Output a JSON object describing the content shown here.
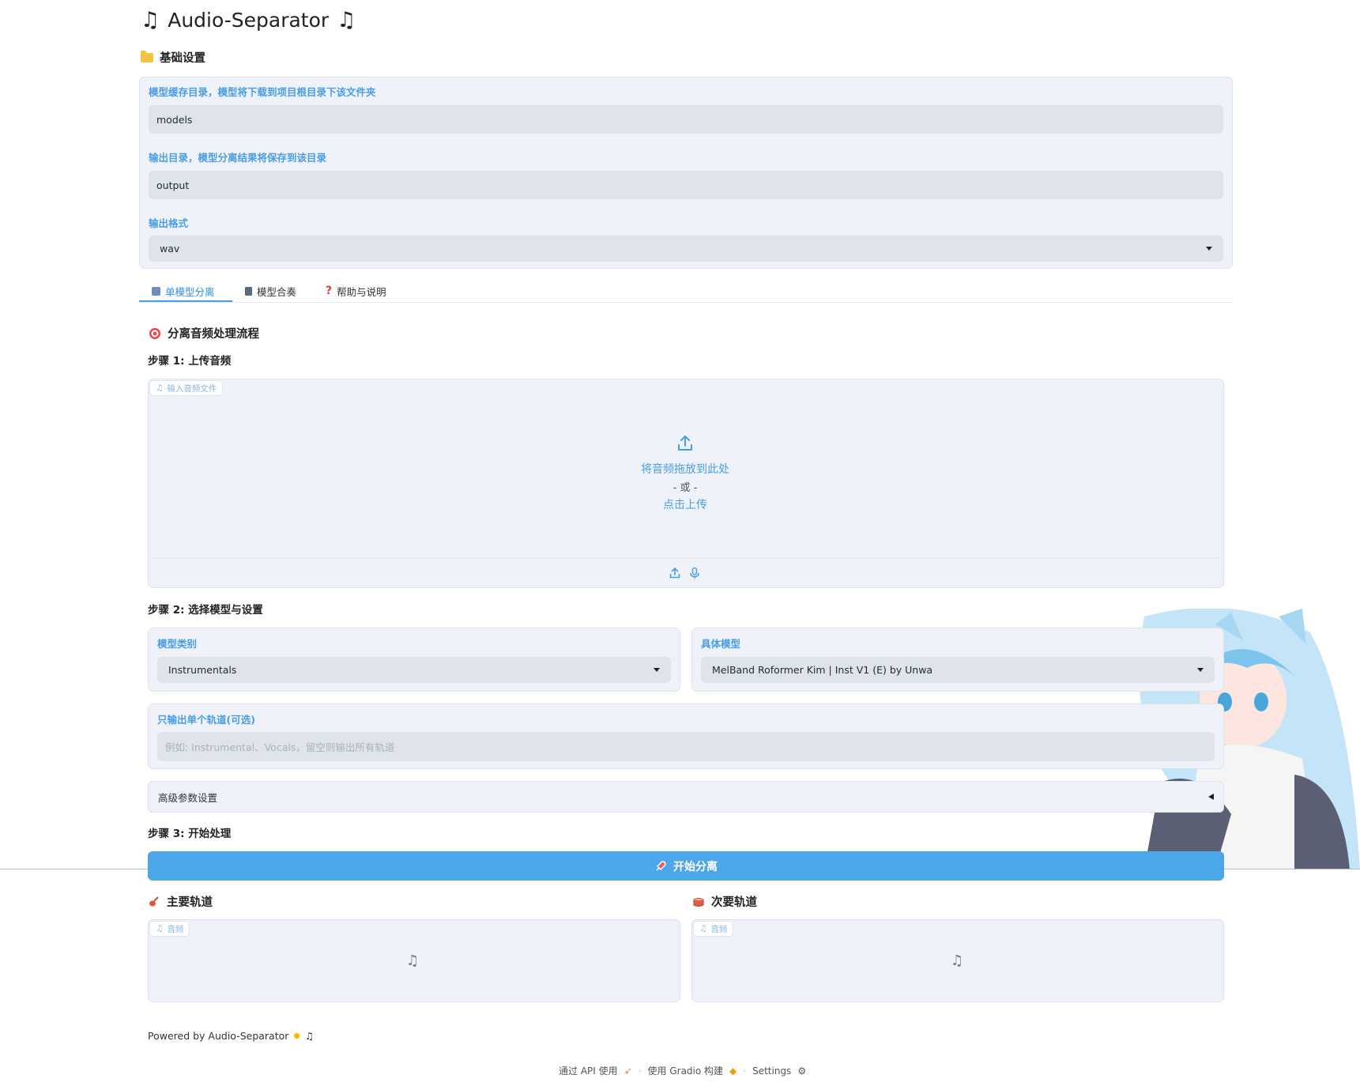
{
  "app": {
    "title": "Audio-Separator",
    "note_glyph": "♫"
  },
  "basic_settings": {
    "heading": "基础设置",
    "model_dir": {
      "label": "模型缓存目录，模型将下载到项目根目录下该文件夹",
      "value": "models"
    },
    "output_dir": {
      "label": "输出目录，模型分离结果将保存到该目录",
      "value": "output"
    },
    "output_format": {
      "label": "输出格式",
      "value": "wav"
    }
  },
  "tabs": [
    {
      "label": "单模型分离",
      "active": true
    },
    {
      "label": "模型合奏",
      "active": false
    },
    {
      "label": "帮助与说明",
      "active": false
    }
  ],
  "flow": {
    "heading": "分离音频处理流程",
    "step1": "步骤 1: 上传音频",
    "upload": {
      "chip": "输入音频文件",
      "drop_text": "将音频拖放到此处",
      "or": "- 或 -",
      "click": "点击上传"
    },
    "step2": "步骤 2: 选择模型与设置",
    "model_type": {
      "label": "模型类别",
      "value": "Instrumentals"
    },
    "model_specific": {
      "label": "具体模型",
      "value": "MelBand Roformer Kim | Inst V1 (E) by Unwa"
    },
    "single_stem": {
      "label": "只输出单个轨道(可选)",
      "placeholder": "例如: Instrumental、Vocals，留空则输出所有轨道"
    },
    "advanced": "高级参数设置",
    "step3": "步骤 3: 开始处理",
    "start_button": "开始分离"
  },
  "outputs": {
    "primary": {
      "heading": "主要轨道",
      "chip": "音频"
    },
    "secondary": {
      "heading": "次要轨道",
      "chip": "音频"
    }
  },
  "footer": {
    "powered": "Powered by Audio-Separator",
    "api": "通过 API 使用",
    "gradio": "使用 Gradio 构建",
    "settings": "Settings"
  },
  "colors": {
    "accent": "#4a9de4",
    "button": "#4ca6ea",
    "panel": "#eff3f9",
    "input": "#dfe3ea"
  }
}
